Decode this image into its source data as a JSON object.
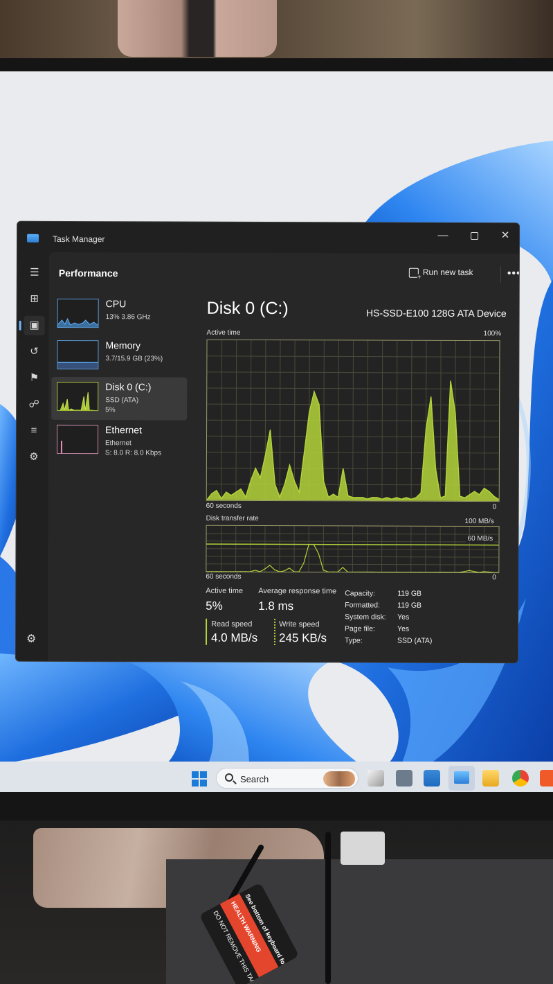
{
  "window": {
    "app_title": "Task Manager",
    "minimize_icon": "minimize-icon",
    "maximize_icon": "maximize-icon",
    "close_icon": "close-icon"
  },
  "nav": {
    "items": [
      {
        "icon": "hamburger-menu-icon",
        "glyph": "☰"
      },
      {
        "icon": "processes-icon",
        "glyph": "⊞"
      },
      {
        "icon": "performance-icon",
        "glyph": "▣",
        "active": true
      },
      {
        "icon": "app-history-icon",
        "glyph": "↺"
      },
      {
        "icon": "startup-apps-icon",
        "glyph": "⚑"
      },
      {
        "icon": "users-icon",
        "glyph": "☍"
      },
      {
        "icon": "details-icon",
        "glyph": "≡"
      },
      {
        "icon": "services-icon",
        "glyph": "⚙"
      }
    ],
    "settings_icon": "settings-icon"
  },
  "header": {
    "title": "Performance",
    "run_new_task": "Run new task",
    "more": "•••"
  },
  "devices": [
    {
      "name": "CPU",
      "sub1": "13% 3.86 GHz",
      "sub2": ""
    },
    {
      "name": "Memory",
      "sub1": "3.7/15.9 GB (23%)",
      "sub2": ""
    },
    {
      "name": "Disk 0 (C:)",
      "sub1": "SSD (ATA)",
      "sub2": "5%",
      "selected": true
    },
    {
      "name": "Ethernet",
      "sub1": "Ethernet",
      "sub2": "S: 8.0 R: 8.0 Kbps"
    }
  ],
  "disk": {
    "title": "Disk 0 (C:)",
    "model": "HS-SSD-E100 128G ATA Device",
    "active_time_label": "Active time",
    "active_time_max": "100%",
    "active_graph_time": "60 seconds",
    "active_graph_min": "0",
    "transfer_label": "Disk transfer rate",
    "transfer_max": "100 MB/s",
    "transfer_marker": "60 MB/s",
    "transfer_graph_time": "60 seconds",
    "transfer_graph_min": "0",
    "graph_color": "#b3d33a"
  },
  "chart_data": [
    {
      "type": "area",
      "title": "Active time",
      "xlabel": "60 seconds",
      "ylim": [
        0,
        100
      ],
      "unit": "%",
      "x": [
        0,
        1,
        2,
        3,
        4,
        5,
        6,
        7,
        8,
        9,
        10,
        11,
        12,
        13,
        14,
        15,
        16,
        17,
        18,
        19,
        20,
        21,
        22,
        23,
        24,
        25,
        26,
        27,
        28,
        29,
        30,
        31,
        32,
        33,
        34,
        35,
        36,
        37,
        38,
        39,
        40,
        41,
        42,
        43,
        44,
        45,
        46,
        47,
        48,
        49,
        50,
        51,
        52,
        53,
        54,
        55,
        56,
        57,
        58,
        59,
        60
      ],
      "values": [
        0,
        4,
        6,
        1,
        5,
        3,
        5,
        7,
        2,
        12,
        20,
        14,
        28,
        44,
        10,
        2,
        10,
        22,
        12,
        5,
        30,
        55,
        68,
        60,
        12,
        2,
        4,
        2,
        20,
        3,
        2,
        2,
        2,
        1,
        2,
        2,
        1,
        2,
        1,
        2,
        1,
        2,
        1,
        2,
        5,
        45,
        65,
        20,
        2,
        3,
        75,
        55,
        3,
        2,
        4,
        6,
        4,
        8,
        6,
        3,
        1
      ]
    },
    {
      "type": "line",
      "title": "Disk transfer rate",
      "xlabel": "60 seconds",
      "ylim": [
        0,
        100
      ],
      "unit": "MB/s",
      "reference_line": 60,
      "x": [
        0,
        1,
        2,
        3,
        4,
        5,
        6,
        7,
        8,
        9,
        10,
        11,
        12,
        13,
        14,
        15,
        16,
        17,
        18,
        19,
        20,
        21,
        22,
        23,
        24,
        25,
        26,
        27,
        28,
        29,
        30,
        31,
        32,
        33,
        34,
        35,
        36,
        37,
        38,
        39,
        40,
        41,
        42,
        43,
        44,
        45,
        46,
        47,
        48,
        49,
        50,
        51,
        52,
        53,
        54,
        55,
        56,
        57,
        58,
        59,
        60
      ],
      "values": [
        0,
        0,
        0,
        0,
        0,
        0,
        0,
        0,
        0,
        0,
        3,
        0,
        6,
        14,
        4,
        0,
        2,
        8,
        0,
        0,
        20,
        60,
        60,
        40,
        4,
        0,
        0,
        0,
        10,
        0,
        0,
        0,
        0,
        0,
        0,
        0,
        0,
        0,
        0,
        0,
        0,
        0,
        0,
        0,
        0,
        0,
        0,
        0,
        0,
        0,
        0,
        0,
        0,
        2,
        4,
        2,
        0,
        2,
        1,
        0,
        0
      ]
    }
  ],
  "stats": {
    "active_time_label": "Active time",
    "active_time_value": "5%",
    "avg_response_label": "Average response time",
    "avg_response_value": "1.8 ms",
    "read_label": "Read speed",
    "read_value": "4.0 MB/s",
    "write_label": "Write speed",
    "write_value": "245 KB/s"
  },
  "properties": [
    {
      "key": "Capacity:",
      "value": "119 GB"
    },
    {
      "key": "Formatted:",
      "value": "119 GB"
    },
    {
      "key": "System disk:",
      "value": "Yes"
    },
    {
      "key": "Page file:",
      "value": "Yes"
    },
    {
      "key": "Type:",
      "value": "SSD (ATA)"
    }
  ],
  "taskbar": {
    "search_label": "Search",
    "icons": [
      "start-icon",
      "search-icon",
      "task-view-icon",
      "calculator-icon",
      "store-icon",
      "task-manager-icon",
      "file-explorer-icon",
      "chrome-icon",
      "brave-icon"
    ]
  },
  "scene": {
    "health_warning": "HEALTH WARNING",
    "tag_text": "DO NOT REMOVE THIS TAG",
    "keyboard_note": "See bottom of keyboard for"
  }
}
